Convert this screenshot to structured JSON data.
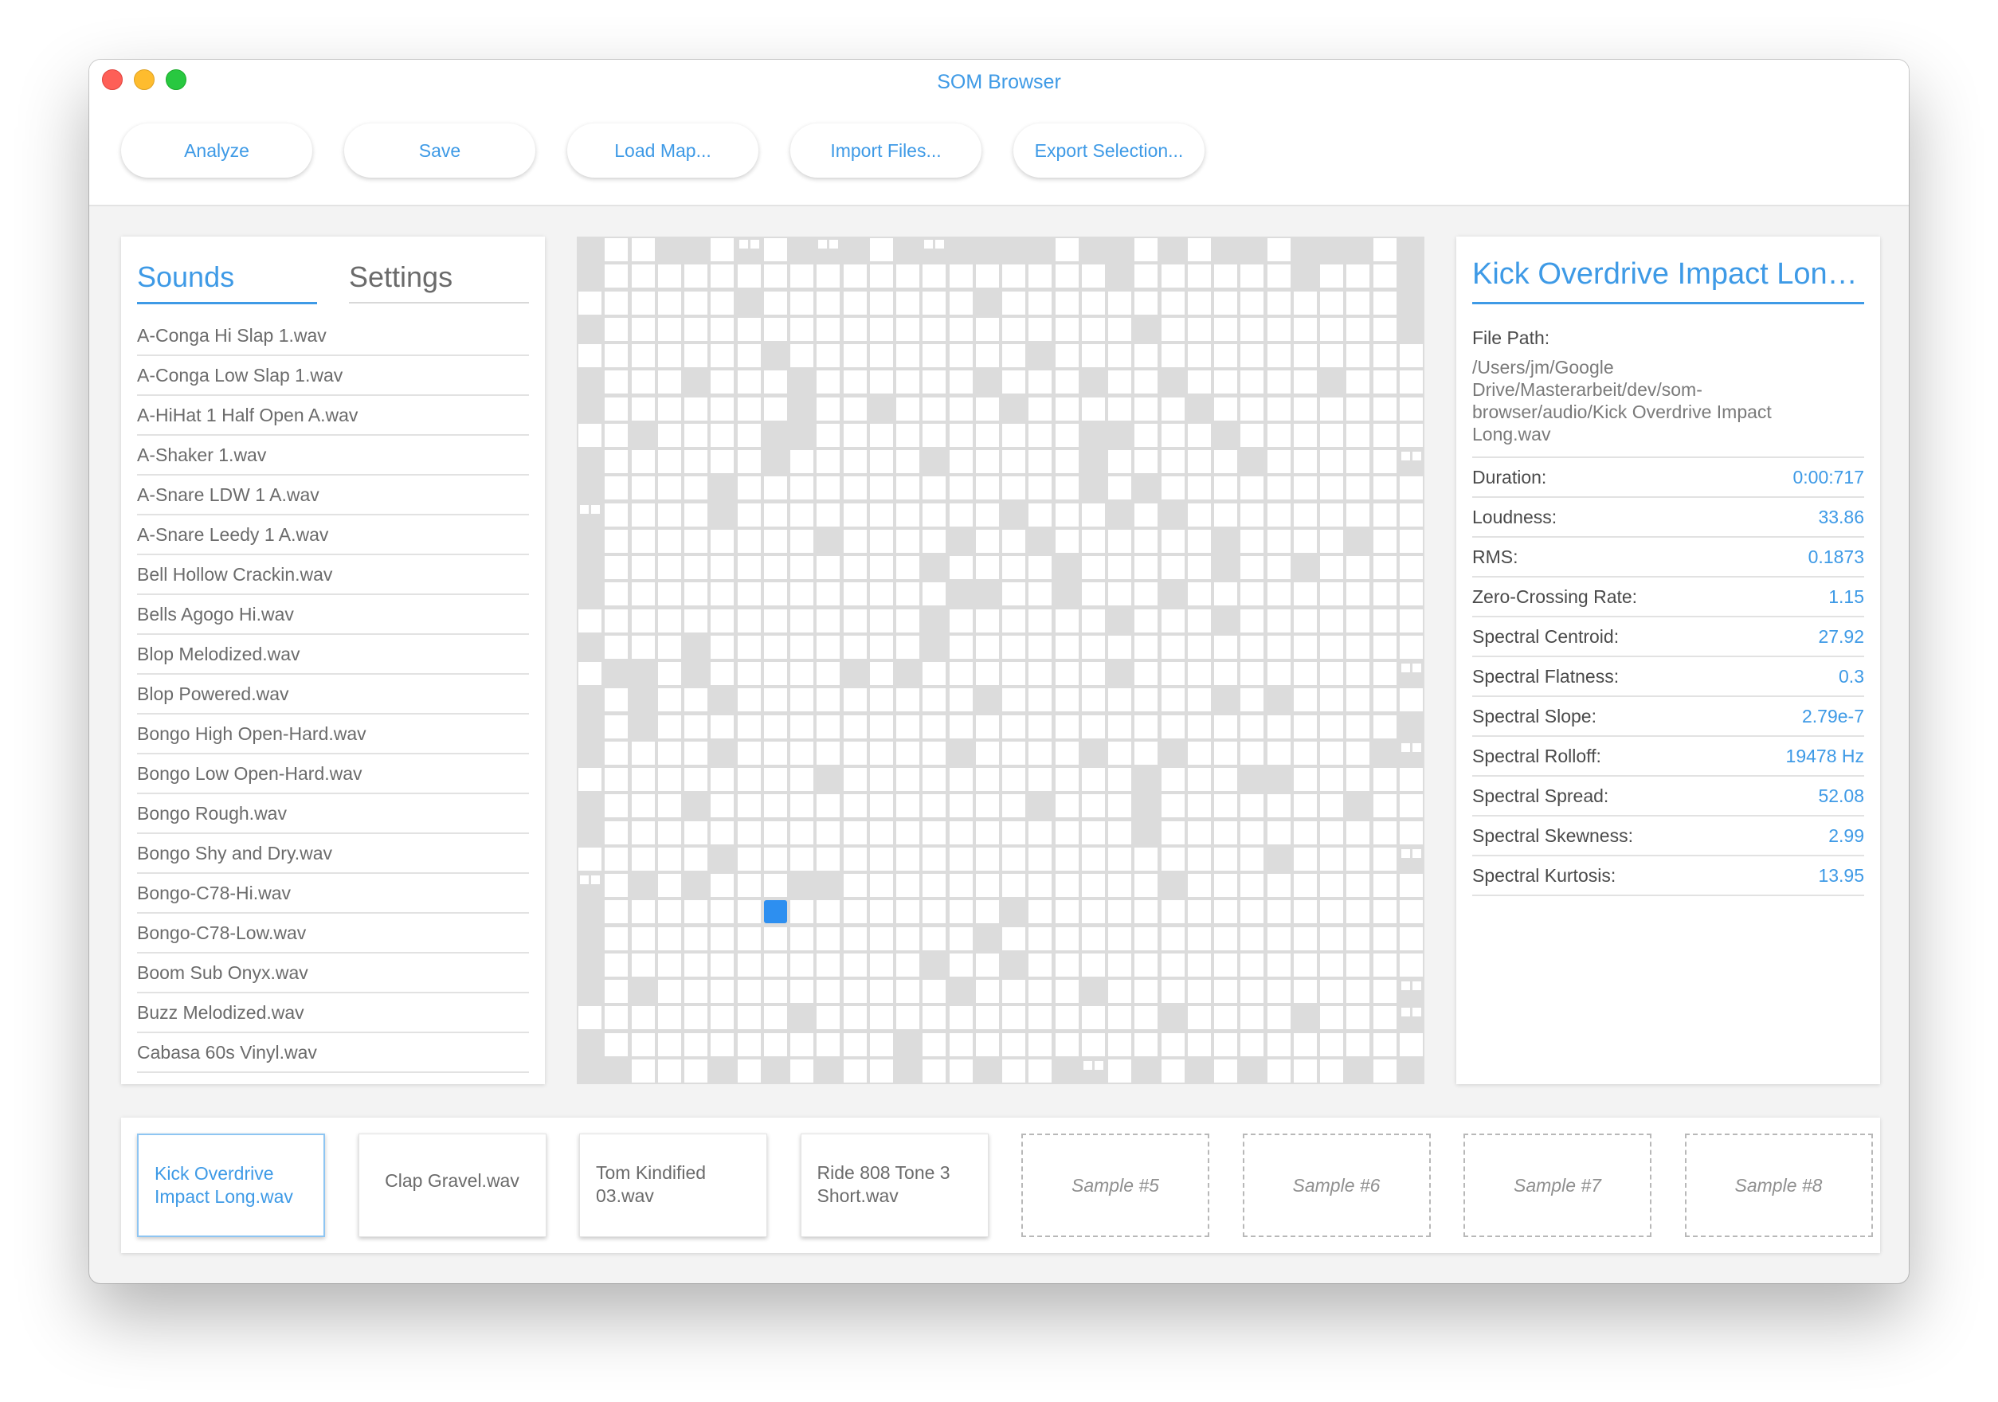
{
  "window": {
    "title": "SOM Browser"
  },
  "toolbar": {
    "analyze": "Analyze",
    "save": "Save",
    "load_map": "Load Map...",
    "import_files": "Import Files...",
    "export_selection": "Export Selection..."
  },
  "sidebar": {
    "tabs": {
      "sounds": "Sounds",
      "settings": "Settings"
    },
    "items": [
      "A-Conga Hi Slap 1.wav",
      "A-Conga Low Slap 1.wav",
      "A-HiHat 1 Half Open A.wav",
      "A-Shaker 1.wav",
      "A-Snare LDW 1 A.wav",
      "A-Snare Leedy 1 A.wav",
      "Bell Hollow Crackin.wav",
      "Bells Agogo Hi.wav",
      "Blop Melodized.wav",
      "Blop Powered.wav",
      "Bongo High Open-Hard.wav",
      "Bongo Low Open-Hard.wav",
      "Bongo Rough.wav",
      "Bongo Shy and Dry.wav",
      "Bongo-C78-Hi.wav",
      "Bongo-C78-Low.wav",
      "Boom Sub Onyx.wav",
      "Buzz Melodized.wav",
      "Cabasa 60s Vinyl.wav"
    ]
  },
  "som": {
    "size": 32,
    "selected": {
      "col": 7,
      "row": 25
    },
    "multi_cells": [
      [
        6,
        0
      ],
      [
        9,
        0
      ],
      [
        13,
        0
      ],
      [
        31,
        8
      ],
      [
        0,
        10
      ],
      [
        31,
        16
      ],
      [
        31,
        19
      ],
      [
        31,
        23
      ],
      [
        0,
        24
      ],
      [
        31,
        28
      ],
      [
        31,
        29
      ],
      [
        19,
        31
      ]
    ],
    "gray_cells": [
      [
        0,
        0
      ],
      [
        3,
        0
      ],
      [
        4,
        0
      ],
      [
        8,
        0
      ],
      [
        10,
        0
      ],
      [
        12,
        0
      ],
      [
        14,
        0
      ],
      [
        15,
        0
      ],
      [
        16,
        0
      ],
      [
        17,
        0
      ],
      [
        19,
        0
      ],
      [
        20,
        0
      ],
      [
        22,
        0
      ],
      [
        24,
        0
      ],
      [
        25,
        0
      ],
      [
        27,
        0
      ],
      [
        28,
        0
      ],
      [
        29,
        0
      ],
      [
        31,
        0
      ],
      [
        0,
        1
      ],
      [
        20,
        1
      ],
      [
        27,
        1
      ],
      [
        31,
        1
      ],
      [
        6,
        2
      ],
      [
        15,
        2
      ],
      [
        31,
        2
      ],
      [
        0,
        3
      ],
      [
        21,
        3
      ],
      [
        31,
        3
      ],
      [
        7,
        4
      ],
      [
        17,
        4
      ],
      [
        0,
        5
      ],
      [
        4,
        5
      ],
      [
        8,
        5
      ],
      [
        15,
        5
      ],
      [
        19,
        5
      ],
      [
        22,
        5
      ],
      [
        28,
        5
      ],
      [
        0,
        6
      ],
      [
        8,
        6
      ],
      [
        11,
        6
      ],
      [
        16,
        6
      ],
      [
        23,
        6
      ],
      [
        2,
        7
      ],
      [
        7,
        7
      ],
      [
        8,
        7
      ],
      [
        19,
        7
      ],
      [
        20,
        7
      ],
      [
        24,
        7
      ],
      [
        0,
        8
      ],
      [
        7,
        8
      ],
      [
        13,
        8
      ],
      [
        19,
        8
      ],
      [
        25,
        8
      ],
      [
        0,
        9
      ],
      [
        5,
        9
      ],
      [
        19,
        9
      ],
      [
        21,
        9
      ],
      [
        5,
        10
      ],
      [
        16,
        10
      ],
      [
        20,
        10
      ],
      [
        22,
        10
      ],
      [
        0,
        11
      ],
      [
        9,
        11
      ],
      [
        14,
        11
      ],
      [
        17,
        11
      ],
      [
        24,
        11
      ],
      [
        29,
        11
      ],
      [
        0,
        12
      ],
      [
        13,
        12
      ],
      [
        18,
        12
      ],
      [
        24,
        12
      ],
      [
        27,
        12
      ],
      [
        0,
        13
      ],
      [
        14,
        13
      ],
      [
        15,
        13
      ],
      [
        18,
        13
      ],
      [
        22,
        13
      ],
      [
        13,
        14
      ],
      [
        20,
        14
      ],
      [
        24,
        14
      ],
      [
        0,
        15
      ],
      [
        4,
        15
      ],
      [
        13,
        15
      ],
      [
        1,
        16
      ],
      [
        2,
        16
      ],
      [
        4,
        16
      ],
      [
        10,
        16
      ],
      [
        12,
        16
      ],
      [
        20,
        16
      ],
      [
        0,
        17
      ],
      [
        2,
        17
      ],
      [
        5,
        17
      ],
      [
        15,
        17
      ],
      [
        24,
        17
      ],
      [
        26,
        17
      ],
      [
        0,
        18
      ],
      [
        2,
        18
      ],
      [
        31,
        18
      ],
      [
        0,
        19
      ],
      [
        5,
        19
      ],
      [
        14,
        19
      ],
      [
        19,
        19
      ],
      [
        22,
        19
      ],
      [
        30,
        19
      ],
      [
        9,
        20
      ],
      [
        21,
        20
      ],
      [
        25,
        20
      ],
      [
        26,
        20
      ],
      [
        0,
        21
      ],
      [
        4,
        21
      ],
      [
        17,
        21
      ],
      [
        21,
        21
      ],
      [
        29,
        21
      ],
      [
        0,
        22
      ],
      [
        21,
        22
      ],
      [
        5,
        23
      ],
      [
        26,
        23
      ],
      [
        2,
        24
      ],
      [
        4,
        24
      ],
      [
        8,
        24
      ],
      [
        9,
        24
      ],
      [
        22,
        24
      ],
      [
        0,
        25
      ],
      [
        16,
        25
      ],
      [
        0,
        26
      ],
      [
        15,
        26
      ],
      [
        0,
        27
      ],
      [
        13,
        27
      ],
      [
        16,
        27
      ],
      [
        0,
        28
      ],
      [
        2,
        28
      ],
      [
        14,
        28
      ],
      [
        19,
        28
      ],
      [
        8,
        29
      ],
      [
        22,
        29
      ],
      [
        27,
        29
      ],
      [
        0,
        30
      ],
      [
        12,
        30
      ],
      [
        0,
        31
      ],
      [
        1,
        31
      ],
      [
        5,
        31
      ],
      [
        7,
        31
      ],
      [
        9,
        31
      ],
      [
        12,
        31
      ],
      [
        15,
        31
      ],
      [
        18,
        31
      ],
      [
        21,
        31
      ],
      [
        23,
        31
      ],
      [
        25,
        31
      ],
      [
        29,
        31
      ],
      [
        31,
        31
      ]
    ]
  },
  "details": {
    "title": "Kick Overdrive Impact Long....",
    "file_path_label": "File Path:",
    "file_path": "/Users/jm/Google Drive/Masterarbeit/dev/som-browser/audio/Kick Overdrive Impact Long.wav",
    "stats": [
      {
        "label": "Duration:",
        "value": "0:00:717"
      },
      {
        "label": "Loudness:",
        "value": "33.86"
      },
      {
        "label": "RMS:",
        "value": "0.1873"
      },
      {
        "label": "Zero-Crossing Rate:",
        "value": "1.15"
      },
      {
        "label": "Spectral Centroid:",
        "value": "27.92"
      },
      {
        "label": "Spectral Flatness:",
        "value": "0.3"
      },
      {
        "label": "Spectral Slope:",
        "value": "2.79e-7"
      },
      {
        "label": "Spectral Rolloff:",
        "value": "19478 Hz"
      },
      {
        "label": "Spectral Spread:",
        "value": "52.08"
      },
      {
        "label": "Spectral Skewness:",
        "value": "2.99"
      },
      {
        "label": "Spectral Kurtosis:",
        "value": "13.95"
      }
    ]
  },
  "slots": [
    {
      "label": "Kick Overdrive Impact Long.wav",
      "filled": true,
      "active": true,
      "align": "left"
    },
    {
      "label": "Clap Gravel.wav",
      "filled": true,
      "active": false,
      "align": "center"
    },
    {
      "label": "Tom Kindified 03.wav",
      "filled": true,
      "active": false,
      "align": "left"
    },
    {
      "label": "Ride 808 Tone 3 Short.wav",
      "filled": true,
      "active": false,
      "align": "left"
    },
    {
      "label": "Sample #5",
      "filled": false
    },
    {
      "label": "Sample #6",
      "filled": false
    },
    {
      "label": "Sample #7",
      "filled": false
    },
    {
      "label": "Sample #8",
      "filled": false
    }
  ],
  "colors": {
    "accent": "#3e9ae6",
    "selected_cell": "#2d8ff0",
    "gray_cell": "#dcdcdc"
  }
}
